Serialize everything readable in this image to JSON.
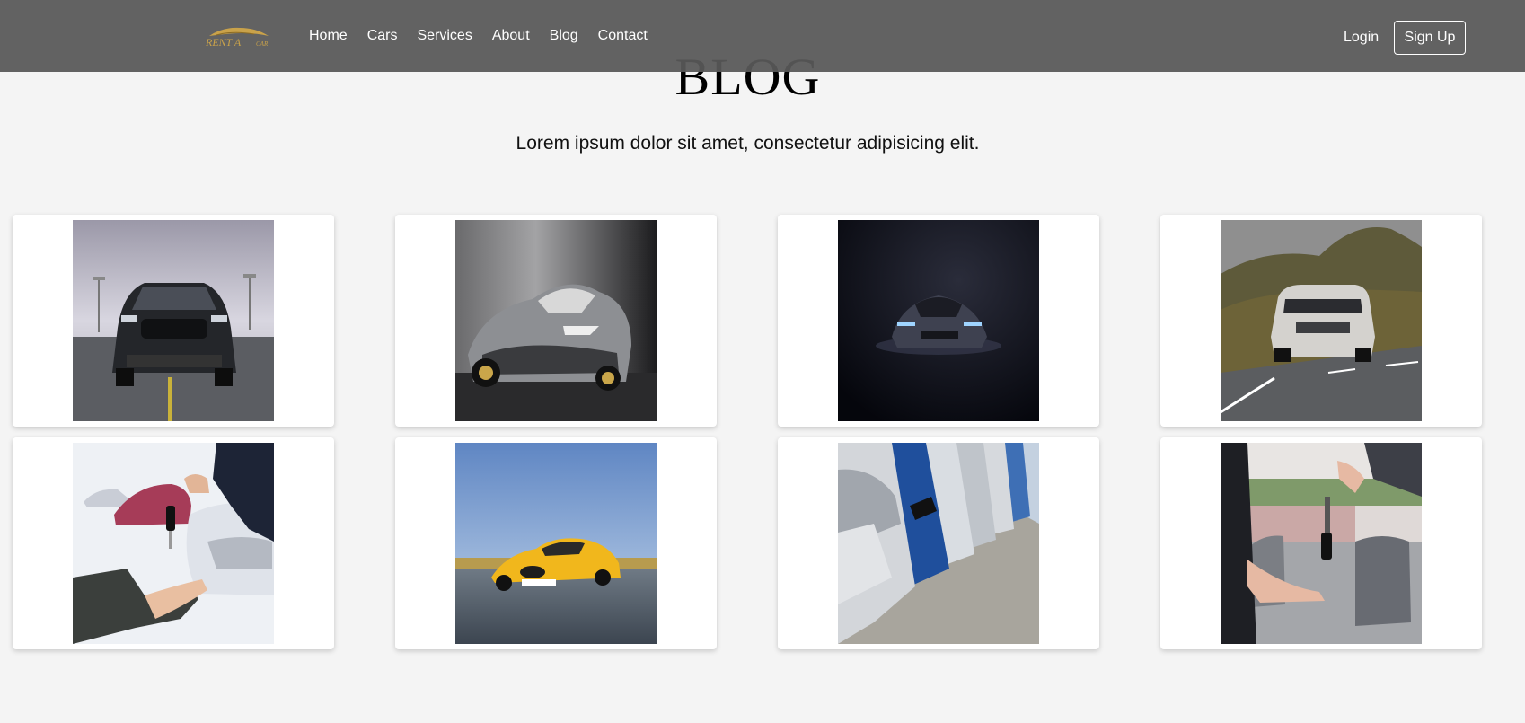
{
  "brand": {
    "logo_text": "RENT A CAR",
    "accent": "#c9a24a"
  },
  "nav": {
    "links": [
      "Home",
      "Cars",
      "Services",
      "About",
      "Blog",
      "Contact"
    ],
    "login": "Login",
    "signup": "Sign Up"
  },
  "hero": {
    "title": "BLOG",
    "subtitle": "Lorem ipsum dolor sit amet, consectetur adipisicing elit."
  },
  "posts": [
    {
      "image": "black-muscle-car-photo"
    },
    {
      "image": "silver-supercar-photo"
    },
    {
      "image": "dark-supercar-photo"
    },
    {
      "image": "white-suv-on-road-photo"
    },
    {
      "image": "car-key-handover-photo"
    },
    {
      "image": "yellow-sports-car-photo"
    },
    {
      "image": "parked-cars-row-photo"
    },
    {
      "image": "key-handover-street-photo"
    }
  ]
}
